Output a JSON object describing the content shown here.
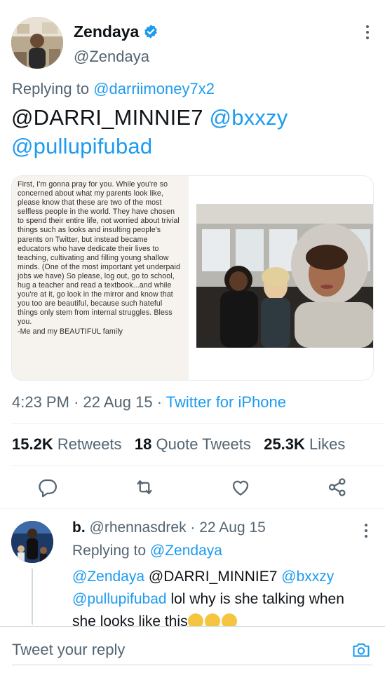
{
  "tweet": {
    "author_name": "Zendaya",
    "author_handle": "@Zendaya",
    "replying_prefix": "Replying to",
    "replying_to": "@darriimoney7x2",
    "mention_1": "@DARRI_MINNIE7",
    "mention_2": "@bxxzy",
    "mention_3": "@pullupifubad",
    "note_text": "First, I'm gonna pray for you. While you're so concerned about what my parents look like, please know that these are two of the most selfless people in the world. They have chosen to spend their entire life, not worried about trivial things such as looks and insulting people's parents on Twitter, but instead became educators who have dedicate their lives to teaching, cultivating and filling young shallow minds. (One of the most important yet underpaid jobs we have) So please, log out, go to school, hug a teacher and read a textbook...and while you're at it, go look in the mirror and know that you too are beautiful, because such hateful things only stem from internal struggles. Bless you.",
    "note_signoff": "-Me and my BEAUTIFUL family",
    "time": "4:23 PM",
    "date": "22 Aug 15",
    "source": "Twitter for iPhone",
    "retweets_count": "15.2K",
    "retweets_label": "Retweets",
    "quotes_count": "18",
    "quotes_label": "Quote Tweets",
    "likes_count": "25.3K",
    "likes_label": "Likes"
  },
  "reply": {
    "name": "b.",
    "handle": "@rhennasdrek",
    "date": "22 Aug 15",
    "replying_prefix": "Replying to",
    "replying_to": "@Zendaya",
    "mention_1": "@Zendaya",
    "mention_2": "@DARRI_MINNIE7",
    "mention_3": "@bxxzy",
    "mention_4": "@pullupifubad",
    "text": "lol why is she talking when she looks like this"
  },
  "compose": {
    "placeholder": "Tweet your reply"
  },
  "colors": {
    "accent": "#1d9bf0",
    "secondary_text": "#536471",
    "primary_text": "#0f1419"
  },
  "icons": {
    "verified": "verified-badge-icon",
    "more": "more-vertical-icon",
    "reply": "reply-icon",
    "retweet": "retweet-icon",
    "like": "heart-icon",
    "share": "share-icon",
    "camera": "camera-icon"
  }
}
